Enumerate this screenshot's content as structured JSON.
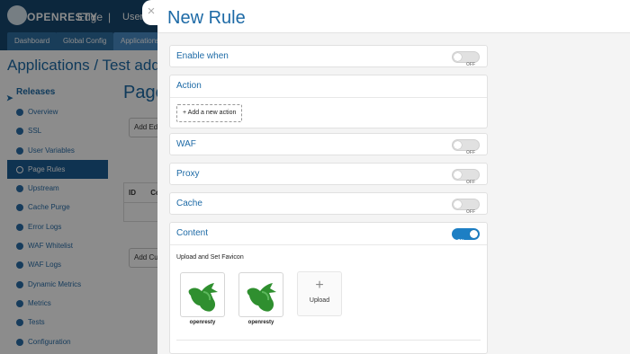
{
  "app": {
    "logo_text": "OPENRESTY",
    "logo_suffix": "Edge",
    "separator": "|",
    "user_menu": "User M"
  },
  "nav_tabs": [
    {
      "label": "Dashboard"
    },
    {
      "label": "Global Config"
    },
    {
      "label": "Applications"
    }
  ],
  "breadcrumb": "Applications / Test add",
  "sidebar": {
    "section": "Releases",
    "items": [
      {
        "label": "Overview",
        "icon": "dashboard-icon"
      },
      {
        "label": "SSL",
        "icon": "file-icon"
      },
      {
        "label": "User Variables",
        "icon": "list-icon"
      },
      {
        "label": "Page Rules",
        "icon": "gear-icon",
        "active": true
      },
      {
        "label": "Upstream",
        "icon": "server-icon"
      },
      {
        "label": "Cache Purge",
        "icon": "cloud-icon"
      },
      {
        "label": "Error Logs",
        "icon": "document-icon"
      },
      {
        "label": "WAF Whitelist",
        "icon": "shield-icon"
      },
      {
        "label": "WAF Logs",
        "icon": "globe-icon"
      },
      {
        "label": "Dynamic Metrics",
        "icon": "gear-icon"
      },
      {
        "label": "Metrics",
        "icon": "chart-icon"
      },
      {
        "label": "Tests",
        "icon": "toggle-icon"
      },
      {
        "label": "Configuration",
        "icon": "gear-icon"
      }
    ]
  },
  "background": {
    "page_heading": "Page",
    "add_edge_btn": "Add Edg",
    "table_col_id": "ID",
    "table_col_c": "Co",
    "add_custom_btn": "Add Cus"
  },
  "modal": {
    "title": "New Rule",
    "close_symbol": "×",
    "sections": {
      "enable_when": {
        "label": "Enable when",
        "toggle": "OFF"
      },
      "action": {
        "label": "Action",
        "add_button": "+ Add a new action"
      },
      "waf": {
        "label": "WAF",
        "toggle": "OFF"
      },
      "proxy": {
        "label": "Proxy",
        "toggle": "OFF"
      },
      "cache": {
        "label": "Cache",
        "toggle": "OFF"
      },
      "content": {
        "label": "Content",
        "toggle": "ON",
        "favicon_label": "Upload and Set Favicon",
        "favicons": [
          {
            "caption": "openresty"
          },
          {
            "caption": "openresty"
          }
        ],
        "upload_symbol": "+",
        "upload_label": "Upload"
      }
    }
  },
  "colors": {
    "accent": "#1d6aa6",
    "topbar": "#16476f",
    "toggle_on": "#1d7fc4",
    "favicon_green": "#2f8f2f"
  }
}
